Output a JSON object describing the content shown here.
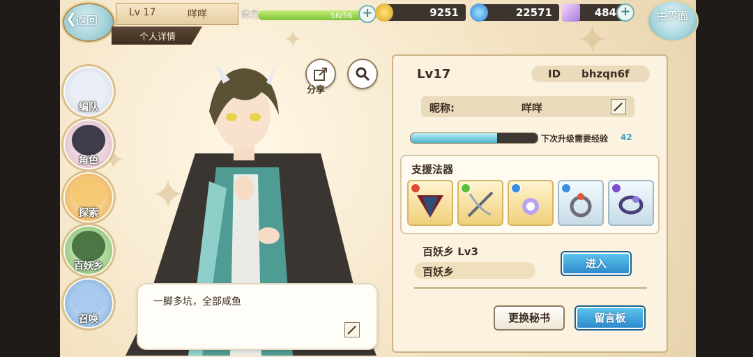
{
  "topbar": {
    "back_label": "返回",
    "home_label": "主界面",
    "player_level": "Lv 17",
    "player_name": "咩咩",
    "tab_label": "个人详情",
    "stamina_label": "体力",
    "stamina_text": "56/56",
    "stamina_fraction": 1.0,
    "gold": "9251",
    "gems": "22571",
    "crystals": "484"
  },
  "nav": [
    {
      "label": "编队",
      "icon": "team-portrait-icon"
    },
    {
      "label": "角色",
      "icon": "character-portrait-icon"
    },
    {
      "label": "探索",
      "icon": "explore-map-icon"
    },
    {
      "label": "百妖乡",
      "icon": "village-house-icon"
    },
    {
      "label": "召唤",
      "icon": "summon-swirl-icon"
    }
  ],
  "actions": {
    "share_label": "分享"
  },
  "bubble": {
    "text": "一脚多坑，全部咸鱼"
  },
  "profile": {
    "level": "Lv17",
    "id_label": "ID",
    "id_value": "bhzqn6f",
    "nickname_label": "昵称:",
    "nickname_value": "咩咩",
    "exp_label": "下次升级需要经验",
    "exp_value": "42",
    "exp_fraction": 0.68
  },
  "artifacts": {
    "title": "支援法器",
    "items": [
      {
        "icon": "fan-artifact-icon",
        "gem_color": "#e34a2a"
      },
      {
        "icon": "crossbow-artifact-icon",
        "gem_color": "#5bbf3a"
      },
      {
        "icon": "pendant-artifact-icon",
        "gem_color": "#3a8de0"
      },
      {
        "icon": "ring-artifact-icon",
        "gem_color": "#3a8de0"
      },
      {
        "icon": "bracelet-artifact-icon",
        "gem_color": "#7b4fd0"
      }
    ]
  },
  "village": {
    "title": "百妖乡  Lv3",
    "name": "百妖乡",
    "enter_label": "进入"
  },
  "buttons": {
    "change_secretary": "更换秘书",
    "message_board": "留言板"
  }
}
